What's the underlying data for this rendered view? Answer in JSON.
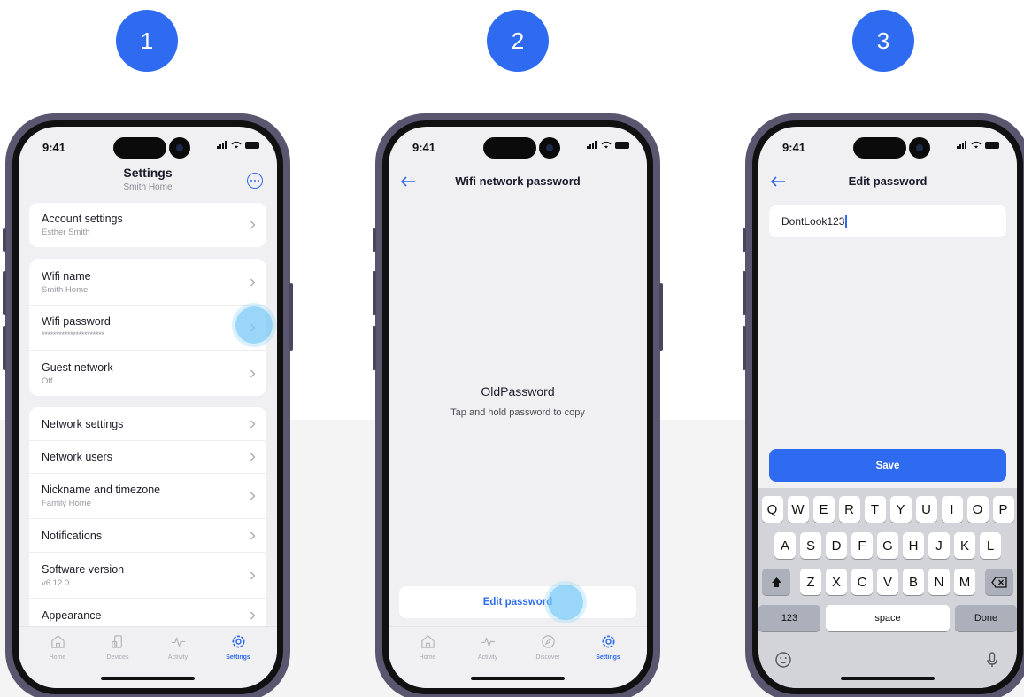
{
  "steps": [
    "1",
    "2",
    "3"
  ],
  "status_time": "9:41",
  "colors": {
    "accent": "#2f6bf0",
    "tap_highlight": "#78c8f5",
    "frame": "#5b5670",
    "screen_bg": "#f0f0f2"
  },
  "screen1": {
    "title": "Settings",
    "subtitle": "Smith Home",
    "more_icon": "more-horizontal-circle-icon",
    "groups": [
      [
        {
          "label": "Account settings",
          "sub": "Esther Smith"
        }
      ],
      [
        {
          "label": "Wifi name",
          "sub": "Smith Home"
        },
        {
          "label": "Wifi password",
          "sub": "**********************"
        },
        {
          "label": "Guest network",
          "sub": "Off"
        }
      ],
      [
        {
          "label": "Network settings"
        },
        {
          "label": "Network users"
        },
        {
          "label": "Nickname and timezone",
          "sub": "Family Home"
        },
        {
          "label": "Notifications"
        },
        {
          "label": "Software version",
          "sub": "v6.12.0"
        },
        {
          "label": "Appearance"
        }
      ]
    ],
    "tabs": [
      {
        "label": "Home",
        "icon": "home-icon"
      },
      {
        "label": "Devices",
        "icon": "devices-icon"
      },
      {
        "label": "Activity",
        "icon": "activity-icon"
      },
      {
        "label": "Settings",
        "icon": "settings-gear-icon",
        "active": true
      }
    ]
  },
  "screen2": {
    "title": "Wifi network password",
    "password": "OldPassword",
    "hint": "Tap and hold password to copy",
    "edit_button": "Edit password",
    "tabs": [
      {
        "label": "Home",
        "icon": "home-icon"
      },
      {
        "label": "Activity",
        "icon": "activity-icon"
      },
      {
        "label": "Discover",
        "icon": "compass-icon"
      },
      {
        "label": "Settings",
        "icon": "settings-gear-icon",
        "active": true
      }
    ]
  },
  "screen3": {
    "title": "Edit password",
    "input_value": "DontLook123",
    "save_button": "Save",
    "keyboard": {
      "row1": [
        "Q",
        "W",
        "E",
        "R",
        "T",
        "Y",
        "U",
        "I",
        "O",
        "P"
      ],
      "row2": [
        "A",
        "S",
        "D",
        "F",
        "G",
        "H",
        "J",
        "K",
        "L"
      ],
      "row3": [
        "Z",
        "X",
        "C",
        "V",
        "B",
        "N",
        "M"
      ],
      "numbers": "123",
      "space": "space",
      "done": "Done"
    }
  }
}
